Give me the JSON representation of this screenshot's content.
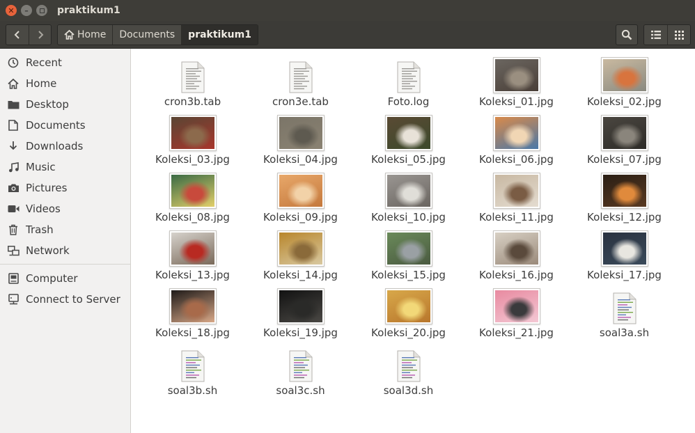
{
  "window": {
    "title": "praktikum1"
  },
  "breadcrumbs": [
    "Home",
    "Documents",
    "praktikum1"
  ],
  "sidebar": {
    "places": [
      {
        "label": "Recent",
        "icon": "clock-icon"
      },
      {
        "label": "Home",
        "icon": "home-icon"
      },
      {
        "label": "Desktop",
        "icon": "folder-icon"
      },
      {
        "label": "Documents",
        "icon": "document-icon"
      },
      {
        "label": "Downloads",
        "icon": "download-icon"
      },
      {
        "label": "Music",
        "icon": "music-icon"
      },
      {
        "label": "Pictures",
        "icon": "camera-icon"
      },
      {
        "label": "Videos",
        "icon": "video-icon"
      },
      {
        "label": "Trash",
        "icon": "trash-icon"
      },
      {
        "label": "Network",
        "icon": "network-icon"
      }
    ],
    "devices": [
      {
        "label": "Computer",
        "icon": "computer-icon"
      },
      {
        "label": "Connect to Server",
        "icon": "server-icon"
      }
    ]
  },
  "files": [
    {
      "name": "cron3b.tab",
      "type": "text"
    },
    {
      "name": "cron3e.tab",
      "type": "text"
    },
    {
      "name": "Foto.log",
      "type": "text"
    },
    {
      "name": "Koleksi_01.jpg",
      "type": "image",
      "colors": [
        "#6b6660",
        "#9a8f80",
        "#4a3f38"
      ]
    },
    {
      "name": "Koleksi_02.jpg",
      "type": "image",
      "colors": [
        "#c9b9a0",
        "#d8743e",
        "#8a8a80"
      ]
    },
    {
      "name": "Koleksi_03.jpg",
      "type": "image",
      "colors": [
        "#5a4634",
        "#8c6a4c",
        "#a8362c"
      ]
    },
    {
      "name": "Koleksi_04.jpg",
      "type": "image",
      "colors": [
        "#7b7568",
        "#5e5a50",
        "#8a8272"
      ]
    },
    {
      "name": "Koleksi_05.jpg",
      "type": "image",
      "colors": [
        "#5a4a34",
        "#e8e2d8",
        "#3c4a2c"
      ]
    },
    {
      "name": "Koleksi_06.jpg",
      "type": "image",
      "colors": [
        "#d98a4a",
        "#f1d6b4",
        "#4a78a8"
      ]
    },
    {
      "name": "Koleksi_07.jpg",
      "type": "image",
      "colors": [
        "#4a4640",
        "#8a857c",
        "#2e2c28"
      ]
    },
    {
      "name": "Koleksi_08.jpg",
      "type": "image",
      "colors": [
        "#3a6a44",
        "#c84a3c",
        "#e2cf6a"
      ]
    },
    {
      "name": "Koleksi_09.jpg",
      "type": "image",
      "colors": [
        "#e8a86a",
        "#f2d2a8",
        "#c4783c"
      ]
    },
    {
      "name": "Koleksi_10.jpg",
      "type": "image",
      "colors": [
        "#9a9692",
        "#e0ded8",
        "#6a6560"
      ]
    },
    {
      "name": "Koleksi_11.jpg",
      "type": "image",
      "colors": [
        "#c8b8a2",
        "#7a5c44",
        "#e4dcd0"
      ]
    },
    {
      "name": "Koleksi_12.jpg",
      "type": "image",
      "colors": [
        "#2a1e14",
        "#e08a3c",
        "#5a3a22"
      ]
    },
    {
      "name": "Koleksi_13.jpg",
      "type": "image",
      "colors": [
        "#d6d2cc",
        "#b82a22",
        "#7a6a5a"
      ]
    },
    {
      "name": "Koleksi_14.jpg",
      "type": "image",
      "colors": [
        "#b8862c",
        "#8a6a3a",
        "#d8c8a0"
      ]
    },
    {
      "name": "Koleksi_15.jpg",
      "type": "image",
      "colors": [
        "#6a8a5a",
        "#9aa0a4",
        "#4a5a40"
      ]
    },
    {
      "name": "Koleksi_16.jpg",
      "type": "image",
      "colors": [
        "#d8d0c4",
        "#5a4a3c",
        "#9a8a7a"
      ]
    },
    {
      "name": "Koleksi_17.jpg",
      "type": "image",
      "colors": [
        "#2a3240",
        "#e8e6e0",
        "#3a4a5a"
      ]
    },
    {
      "name": "Koleksi_18.jpg",
      "type": "image",
      "colors": [
        "#1e1a18",
        "#a86a4a",
        "#d8a888"
      ]
    },
    {
      "name": "Koleksi_19.jpg",
      "type": "image",
      "colors": [
        "#121212",
        "#2a2a28",
        "#4a4844"
      ]
    },
    {
      "name": "Koleksi_20.jpg",
      "type": "image",
      "colors": [
        "#d8a84a",
        "#f2d878",
        "#b8762c"
      ]
    },
    {
      "name": "Koleksi_21.jpg",
      "type": "image",
      "colors": [
        "#e88aa0",
        "#3a3a3c",
        "#f4c8d4"
      ]
    },
    {
      "name": "soal3a.sh",
      "type": "script"
    },
    {
      "name": "soal3b.sh",
      "type": "script"
    },
    {
      "name": "soal3c.sh",
      "type": "script"
    },
    {
      "name": "soal3d.sh",
      "type": "script"
    }
  ]
}
